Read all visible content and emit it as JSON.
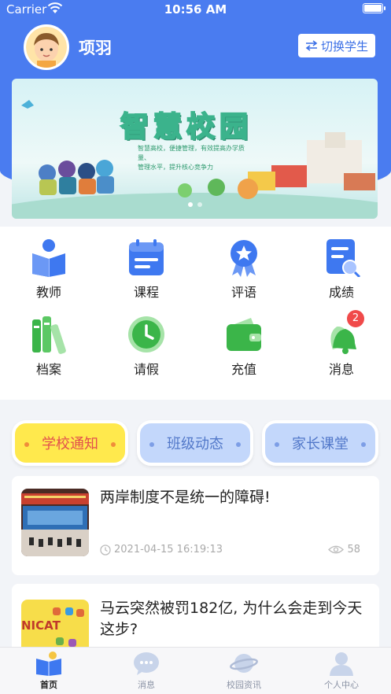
{
  "status_bar": {
    "carrier": "Carrier",
    "time": "10:56 AM"
  },
  "profile": {
    "name": "项羽",
    "switch_label": "切换学生",
    "switch_icon": "swap-arrows-icon"
  },
  "banner": {
    "title": "智慧校园",
    "subtitle_line1": "智慧高校，便捷管理，有效提高办学质量、",
    "subtitle_line2": "管理水平，提升核心竞争力"
  },
  "grid": [
    {
      "label": "教师",
      "icon": "teacher-icon"
    },
    {
      "label": "课程",
      "icon": "course-calendar-icon"
    },
    {
      "label": "评语",
      "icon": "comment-medal-icon"
    },
    {
      "label": "成绩",
      "icon": "grade-report-icon"
    },
    {
      "label": "档案",
      "icon": "archive-books-icon"
    },
    {
      "label": "请假",
      "icon": "leave-clock-icon"
    },
    {
      "label": "充值",
      "icon": "wallet-icon"
    },
    {
      "label": "消息",
      "icon": "bell-icon",
      "badge": "2"
    }
  ],
  "tabs": [
    {
      "label": "学校通知",
      "active": true
    },
    {
      "label": "班级动态",
      "active": false
    },
    {
      "label": "家长课堂",
      "active": false
    }
  ],
  "news": [
    {
      "title": "两岸制度不是统一的障碍!",
      "time": "2021-04-15 16:19:13",
      "views": "58"
    },
    {
      "title": "马云突然被罚182亿, 为什么会走到今天这步?",
      "thumb_text": "NICAT"
    }
  ],
  "tabbar": [
    {
      "label": "首页",
      "icon": "home-book-icon",
      "active": true
    },
    {
      "label": "消息",
      "icon": "chat-bubble-icon",
      "active": false
    },
    {
      "label": "校园资讯",
      "icon": "planet-icon",
      "active": false
    },
    {
      "label": "个人中心",
      "icon": "user-profile-icon",
      "active": false
    }
  ],
  "colors": {
    "primary": "#4a7cf0",
    "active_tab_bg": "#ffe94d",
    "active_tab_text": "#e2504d",
    "inactive_tab_bg": "#c3d7fb",
    "badge": "#f04a4a"
  }
}
